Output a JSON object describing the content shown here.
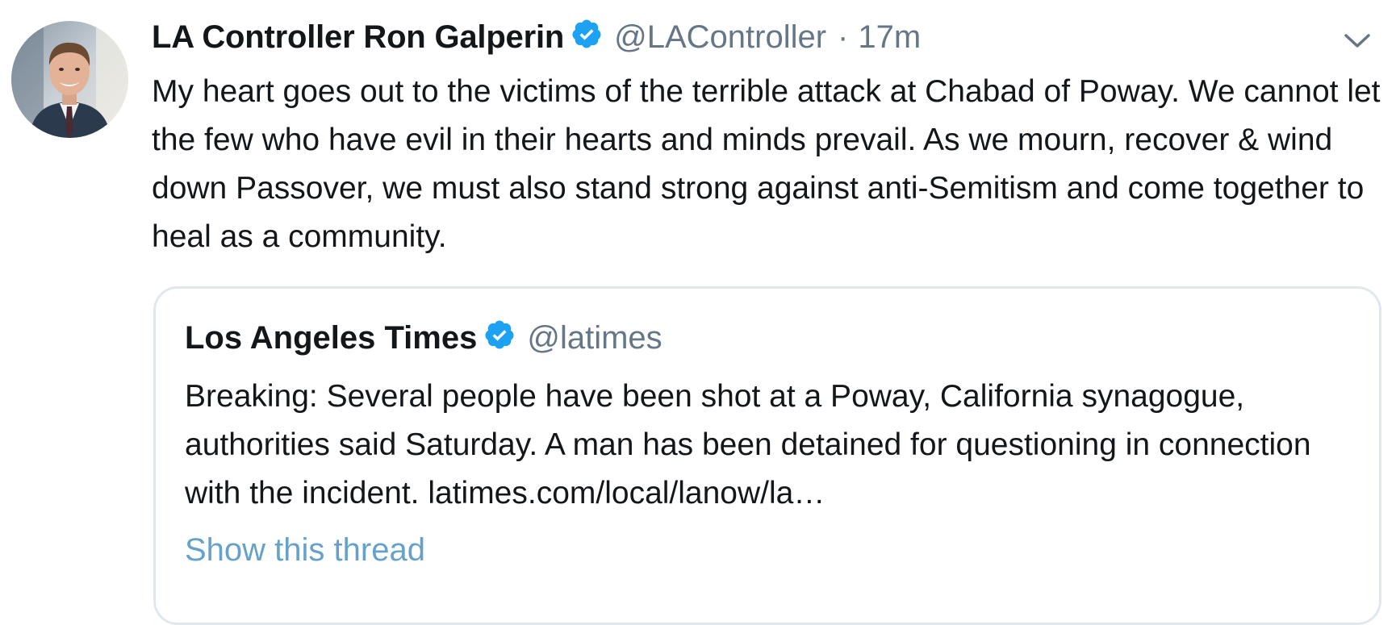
{
  "tweet": {
    "author_name": "LA Controller Ron Galperin",
    "handle": "@LAController",
    "separator": "·",
    "time": "17m",
    "verified_icon": "verified-badge-icon",
    "caret_icon": "chevron-down-icon",
    "text": "My heart goes out to the victims of the terrible attack at Chabad of Poway. We cannot let the few who have evil in their hearts and minds prevail. As we mourn, recover & wind down Passover, we must also stand strong against anti-Semitism and come together to heal as a community."
  },
  "quoted_tweet": {
    "author_name": "Los Angeles Times",
    "handle": "@latimes",
    "verified_icon": "verified-badge-icon",
    "text": "Breaking: Several people have been shot at a Poway, California synagogue, authorities said Saturday. A man has been detained for questioning in connection with the incident. latimes.com/local/lanow/la…",
    "show_thread_label": "Show this thread"
  },
  "colors": {
    "text_primary": "#14171a",
    "text_secondary": "#657786",
    "verified_blue": "#1da1f2",
    "link_blue": "#66a1c9",
    "border": "#e1e8ed"
  }
}
